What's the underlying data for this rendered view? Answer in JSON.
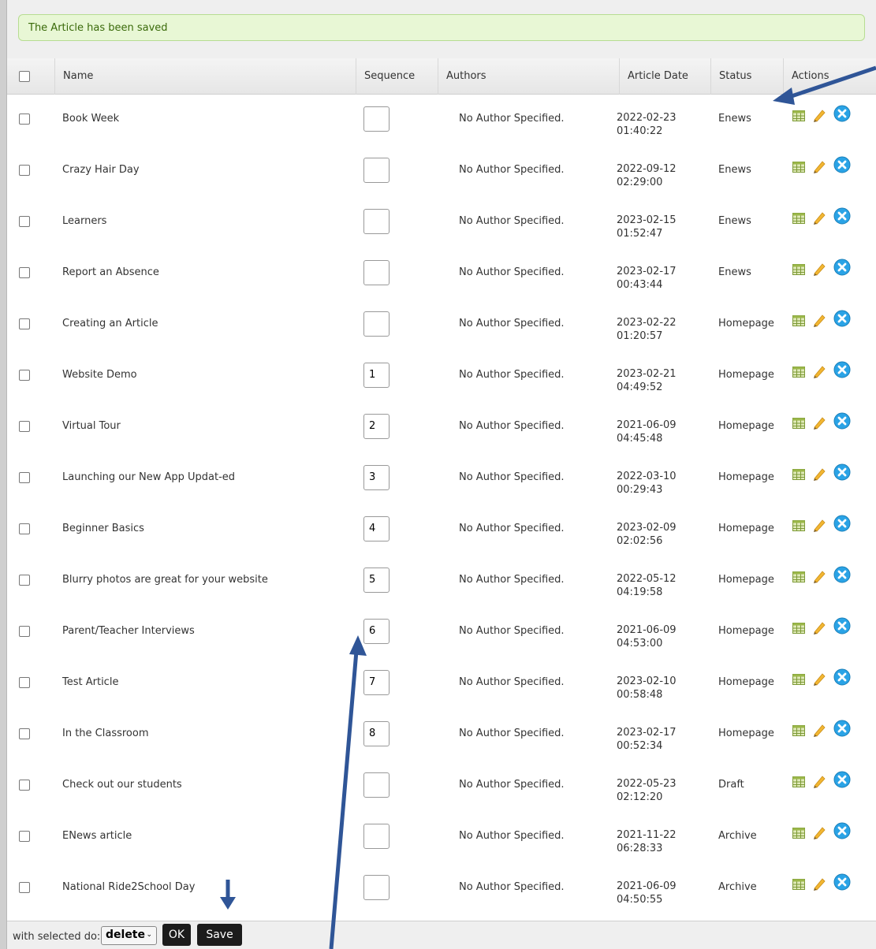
{
  "alert": {
    "message": "The Article has been saved"
  },
  "table": {
    "headers": {
      "name": "Name",
      "sequence": "Sequence",
      "authors": "Authors",
      "article_date": "Article Date",
      "status": "Status",
      "actions": "Actions"
    },
    "rows": [
      {
        "name": "Book Week",
        "sequence": "",
        "author": "No Author Specified.",
        "date": "2022-02-23",
        "time": "01:40:22",
        "status": "Enews"
      },
      {
        "name": "Crazy Hair Day",
        "sequence": "",
        "author": "No Author Specified.",
        "date": "2022-09-12",
        "time": "02:29:00",
        "status": "Enews"
      },
      {
        "name": "Learners",
        "sequence": "",
        "author": "No Author Specified.",
        "date": "2023-02-15",
        "time": "01:52:47",
        "status": "Enews"
      },
      {
        "name": "Report an Absence",
        "sequence": "",
        "author": "No Author Specified.",
        "date": "2023-02-17",
        "time": "00:43:44",
        "status": "Enews"
      },
      {
        "name": "Creating an Article",
        "sequence": "",
        "author": "No Author Specified.",
        "date": "2023-02-22",
        "time": "01:20:57",
        "status": "Homepage"
      },
      {
        "name": "Website Demo",
        "sequence": "1",
        "author": "No Author Specified.",
        "date": "2023-02-21",
        "time": "04:49:52",
        "status": "Homepage"
      },
      {
        "name": "Virtual Tour",
        "sequence": "2",
        "author": "No Author Specified.",
        "date": "2021-06-09",
        "time": "04:45:48",
        "status": "Homepage"
      },
      {
        "name": "Launching our New App Updat-ed",
        "sequence": "3",
        "author": "No Author Specified.",
        "date": "2022-03-10",
        "time": "00:29:43",
        "status": "Homepage"
      },
      {
        "name": "Beginner Basics",
        "sequence": "4",
        "author": "No Author Specified.",
        "date": "2023-02-09",
        "time": "02:02:56",
        "status": "Homepage"
      },
      {
        "name": "Blurry photos are great for your website",
        "sequence": "5",
        "author": "No Author Specified.",
        "date": "2022-05-12",
        "time": "04:19:58",
        "status": "Homepage"
      },
      {
        "name": "Parent/Teacher Interviews",
        "sequence": "6",
        "author": "No Author Specified.",
        "date": "2021-06-09",
        "time": "04:53:00",
        "status": "Homepage"
      },
      {
        "name": "Test Article",
        "sequence": "7",
        "author": "No Author Specified.",
        "date": "2023-02-10",
        "time": "00:58:48",
        "status": "Homepage"
      },
      {
        "name": "In the Classroom",
        "sequence": "8",
        "author": "No Author Specified.",
        "date": "2023-02-17",
        "time": "00:52:34",
        "status": "Homepage"
      },
      {
        "name": "Check out our students",
        "sequence": "",
        "author": "No Author Specified.",
        "date": "2022-05-23",
        "time": "02:12:20",
        "status": "Draft"
      },
      {
        "name": "ENews article",
        "sequence": "",
        "author": "No Author Specified.",
        "date": "2021-11-22",
        "time": "06:28:33",
        "status": "Archive"
      },
      {
        "name": "National Ride2School Day",
        "sequence": "",
        "author": "No Author Specified.",
        "date": "2021-06-09",
        "time": "04:50:55",
        "status": "Archive"
      }
    ]
  },
  "footer": {
    "label": "with selected do:",
    "select_value": "delete",
    "ok_label": "OK",
    "save_label": "Save"
  },
  "icons": {
    "view": "table-view-icon",
    "edit": "pencil-icon",
    "delete": "delete-circle-icon",
    "annotation": "arrow-annotation"
  },
  "colors": {
    "alert_bg": "#e8f7d5",
    "alert_text": "#3a6a0a",
    "delete_icon": "#2aa3e6",
    "edit_icon": "#f2b632",
    "annotation_arrow": "#2f5597",
    "button_bg": "#1c1c1c"
  }
}
